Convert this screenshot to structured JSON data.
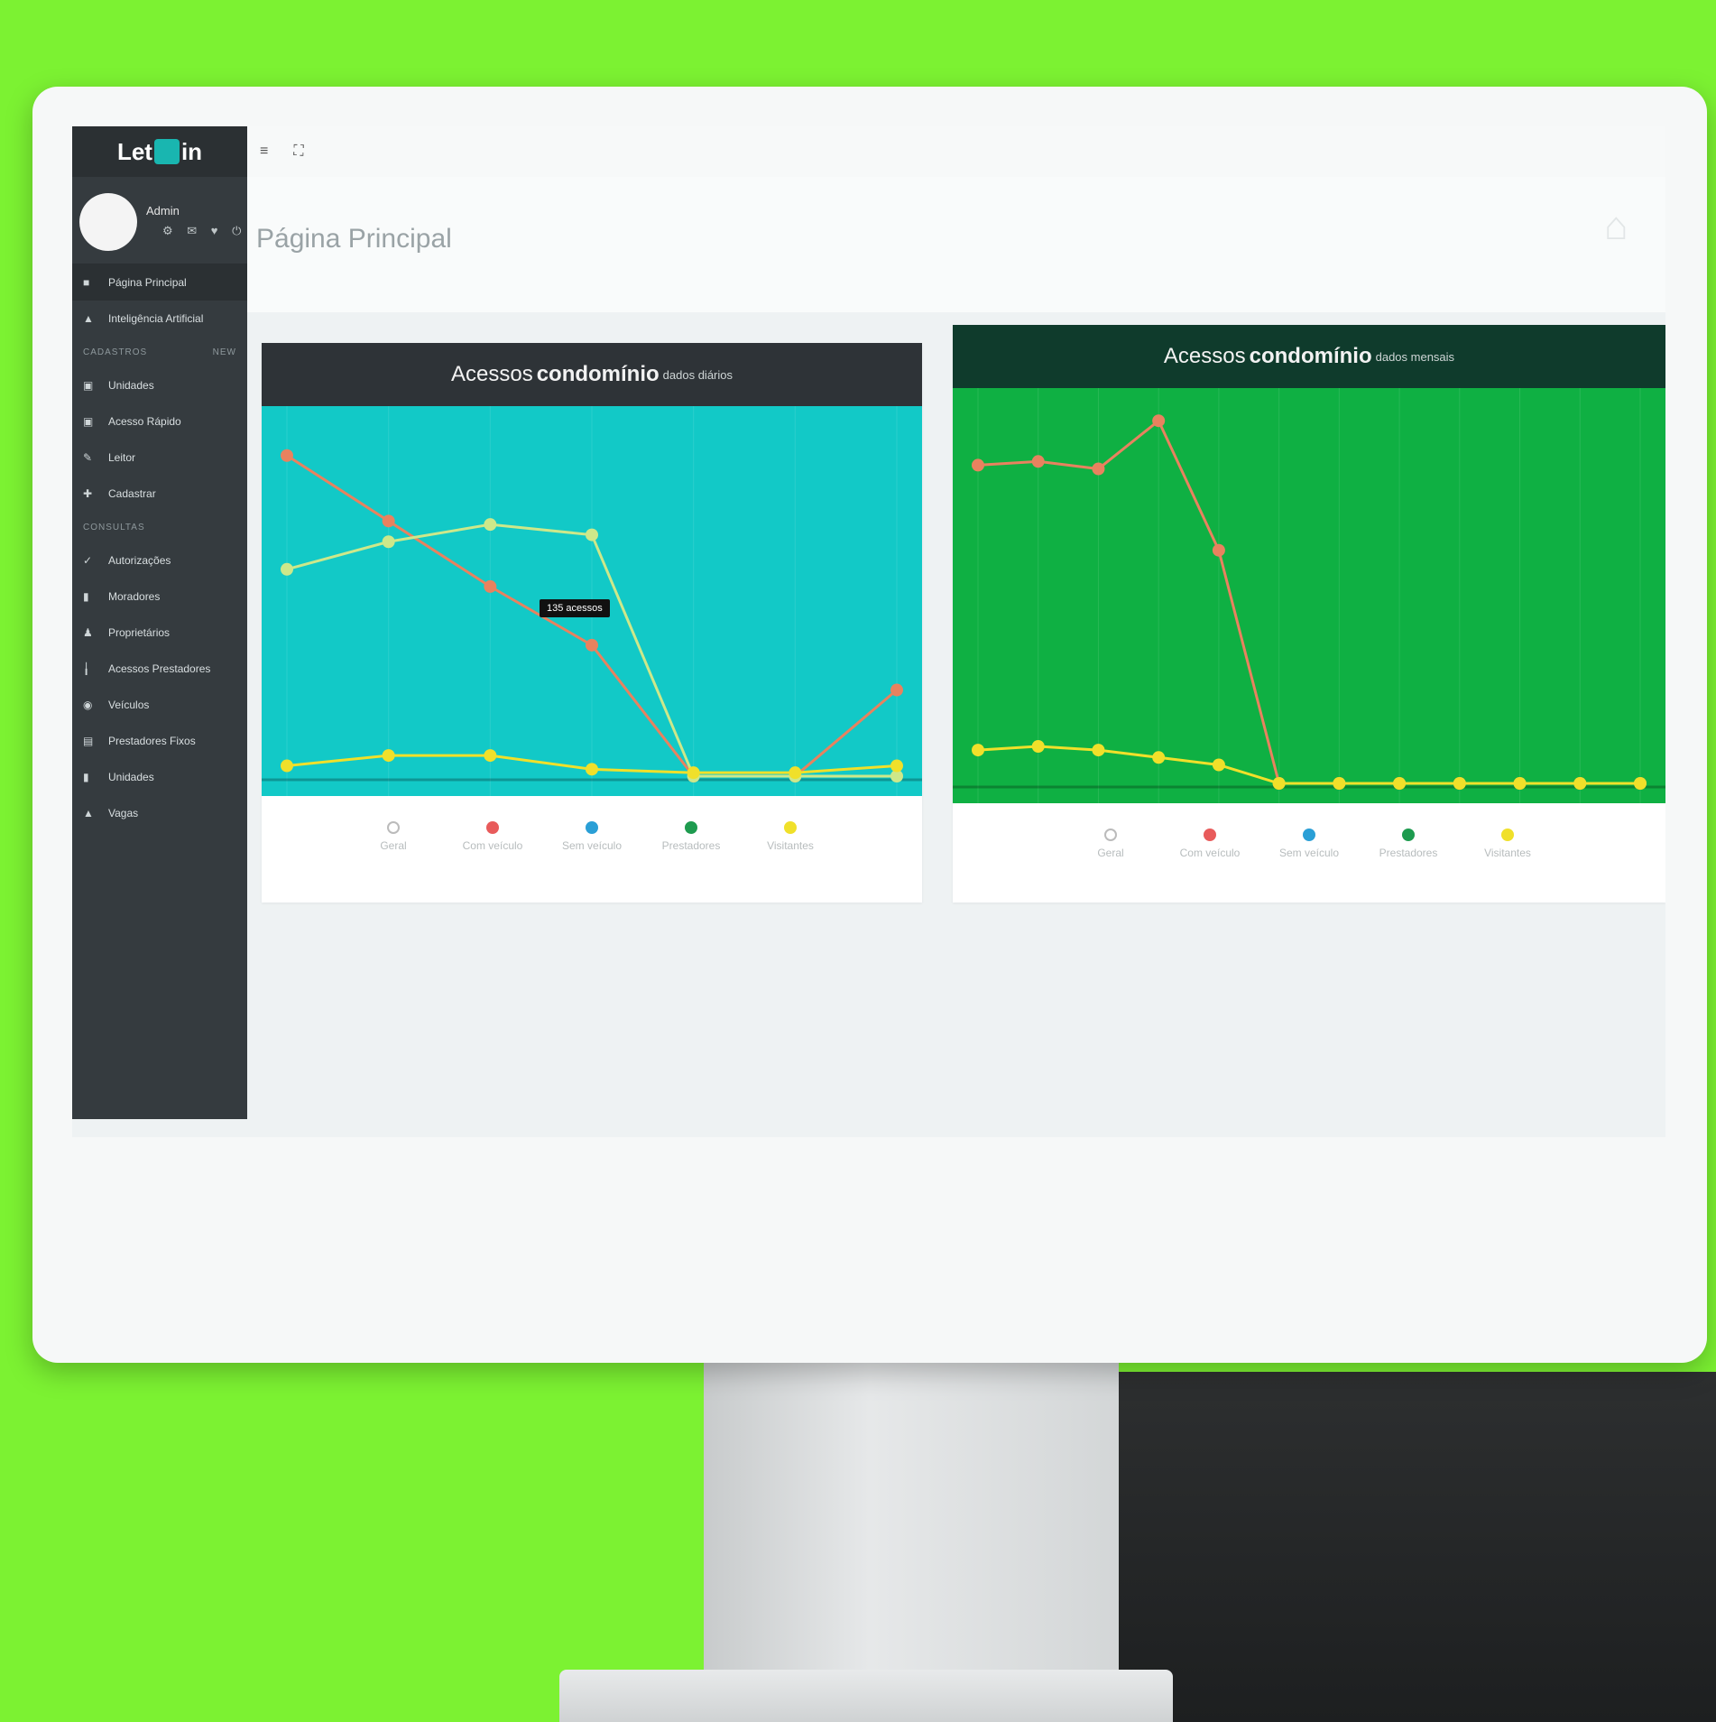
{
  "app": {
    "logo_left": "Let",
    "logo_right": "in"
  },
  "profile": {
    "name": "Admin",
    "icons": "⚙ ✉ ♥ ⏻"
  },
  "sidebar": {
    "items_top": [
      {
        "label": "Página Principal",
        "icon": "home-icon"
      },
      {
        "label": "Inteligência Artificial",
        "icon": "user-icon"
      }
    ],
    "section1": {
      "title": "CADASTROS",
      "badge": "NEW"
    },
    "items_mid": [
      {
        "label": "Unidades",
        "icon": "building-icon"
      },
      {
        "label": "Acesso Rápido",
        "icon": "bolt-icon"
      },
      {
        "label": "Leitor",
        "icon": "reader-icon"
      },
      {
        "label": "Cadastrar",
        "icon": "user-plus-icon"
      }
    ],
    "section2": {
      "title": "CONSULTAS"
    },
    "items_bottom": [
      {
        "label": "Autorizações",
        "icon": "check-icon"
      },
      {
        "label": "Moradores",
        "icon": "person-icon"
      },
      {
        "label": "Proprietários",
        "icon": "users-icon"
      },
      {
        "label": "Acessos Prestadores",
        "icon": "wrench-icon"
      },
      {
        "label": "Veículos",
        "icon": "car-icon"
      },
      {
        "label": "Prestadores Fixos",
        "icon": "list-icon"
      },
      {
        "label": "Unidades",
        "icon": "building-icon"
      },
      {
        "label": "Vagas",
        "icon": "parking-icon"
      }
    ]
  },
  "page": {
    "title": "Página Principal"
  },
  "panels": [
    {
      "title_pre": "Acessos",
      "title_bold": "condomínio",
      "title_post": "dados diários",
      "header_color": "#2e3337",
      "chart_bg": "#12c9c7",
      "tooltip": "135 acessos"
    },
    {
      "title_pre": "Acessos",
      "title_bold": "condomínio",
      "title_post": "dados mensais",
      "header_color": "#0f3b2c",
      "chart_bg": "#0fb043"
    }
  ],
  "legend": [
    {
      "label": "Geral",
      "color": "#ffffff"
    },
    {
      "label": "Com veículo",
      "color": "#e85b5b"
    },
    {
      "label": "Sem veículo",
      "color": "#2a9fd6"
    },
    {
      "label": "Prestadores",
      "color": "#1e9b4f"
    },
    {
      "label": "Visitantes",
      "color": "#f0e02a"
    }
  ],
  "chart_data": [
    {
      "type": "line",
      "x": [
        1,
        2,
        3,
        4,
        5,
        6,
        7
      ],
      "ylim": [
        0,
        100
      ],
      "series": [
        {
          "values": [
            93,
            74,
            55,
            38,
            0,
            0,
            25
          ],
          "color": "#e8825f"
        },
        {
          "values": [
            60,
            68,
            73,
            70,
            0,
            0,
            0
          ],
          "color": "#cde88a"
        },
        {
          "values": [
            3,
            6,
            6,
            2,
            1,
            1,
            3
          ],
          "color": "#f0e02a"
        }
      ]
    },
    {
      "type": "line",
      "x": [
        1,
        2,
        3,
        4,
        5,
        6,
        7,
        8,
        9,
        10,
        11,
        12
      ],
      "ylim": [
        0,
        100
      ],
      "series": [
        {
          "values": [
            86,
            87,
            85,
            98,
            63,
            0,
            0,
            0,
            0,
            0,
            0,
            0
          ],
          "color": "#e8825f"
        },
        {
          "values": [
            9,
            10,
            9,
            7,
            5,
            0,
            0,
            0,
            0,
            0,
            0,
            0
          ],
          "color": "#f0e02a"
        }
      ]
    }
  ]
}
